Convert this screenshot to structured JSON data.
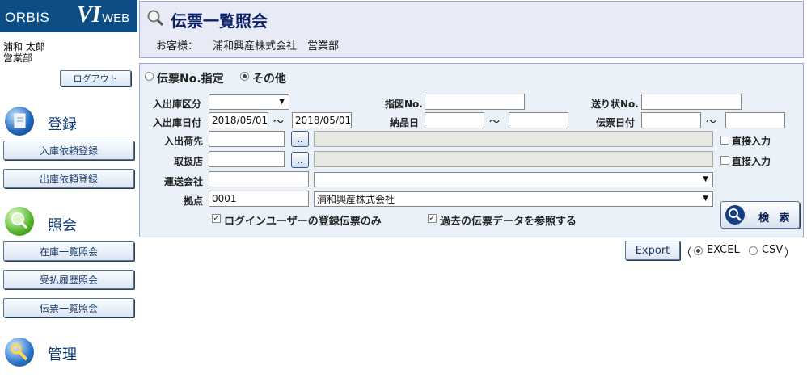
{
  "sidebar": {
    "logo": {
      "part1": "ORBIS",
      "part2": "VI",
      "part3": "WEB"
    },
    "user_name": "浦和 太郎",
    "user_dept": "営業部",
    "logout_label": "ログアウト",
    "sections": {
      "register": {
        "title": "登録",
        "items": [
          "入庫依頼登録",
          "出庫依頼登録"
        ]
      },
      "inquiry": {
        "title": "照会",
        "items": [
          "在庫一覧照会",
          "受払履歴照会",
          "伝票一覧照会"
        ]
      },
      "admin": {
        "title": "管理"
      }
    }
  },
  "header": {
    "title": "伝票一覧照会",
    "customer_label": "お客様：",
    "customer_name": "浦和興産株式会社　営業部"
  },
  "form": {
    "mode_options": {
      "slip_no": "伝票No.指定",
      "other": "その他"
    },
    "mode_selected": "other",
    "labels": {
      "io_type": "入出庫区分",
      "io_date": "入出庫日付",
      "destination": "入出荷先",
      "dealer": "取扱店",
      "carrier": "運送会社",
      "base": "拠点",
      "instruction_no": "指図No.",
      "delivery_date": "納品日",
      "invoice_no": "送り状No.",
      "slip_date": "伝票日付",
      "direct_input": "直接入力",
      "login_user_only": "ログインユーザーの登録伝票のみ",
      "past_data": "過去の伝票データを参照する"
    },
    "tilde": "〜",
    "values": {
      "io_date_from": "2018/05/01",
      "io_date_to": "2018/05/01",
      "base_code": "0001",
      "base_name": "浦和興産株式会社"
    },
    "lookup_button": "..",
    "search_label": "検 索"
  },
  "export": {
    "label": "Export",
    "open_paren": "（",
    "close_paren": "）",
    "options": [
      "EXCEL",
      "CSV"
    ],
    "selected": "EXCEL"
  }
}
